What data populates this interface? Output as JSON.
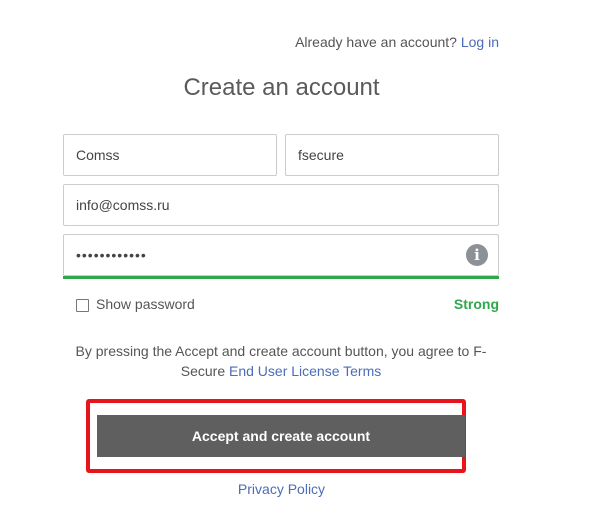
{
  "header": {
    "login_prompt": "Already have an account?",
    "login_link": "Log in"
  },
  "title": "Create an account",
  "form": {
    "first_name": "Comss",
    "last_name": "fsecure",
    "email": "info@comss.ru",
    "password_masked": "••••••••••••",
    "info_icon": "i",
    "show_password_label": "Show password",
    "show_password_checked": false,
    "strength_label": "Strong",
    "strength_color": "#2ea84a"
  },
  "terms": {
    "text": "By pressing the Accept and create account button, you agree to F-Secure",
    "link": "End User License Terms"
  },
  "accept_button": "Accept and create account",
  "privacy_link": "Privacy Policy",
  "colors": {
    "link": "#4b6cb7",
    "button_bg": "#5f5f5f",
    "highlight": "#e8141c"
  }
}
